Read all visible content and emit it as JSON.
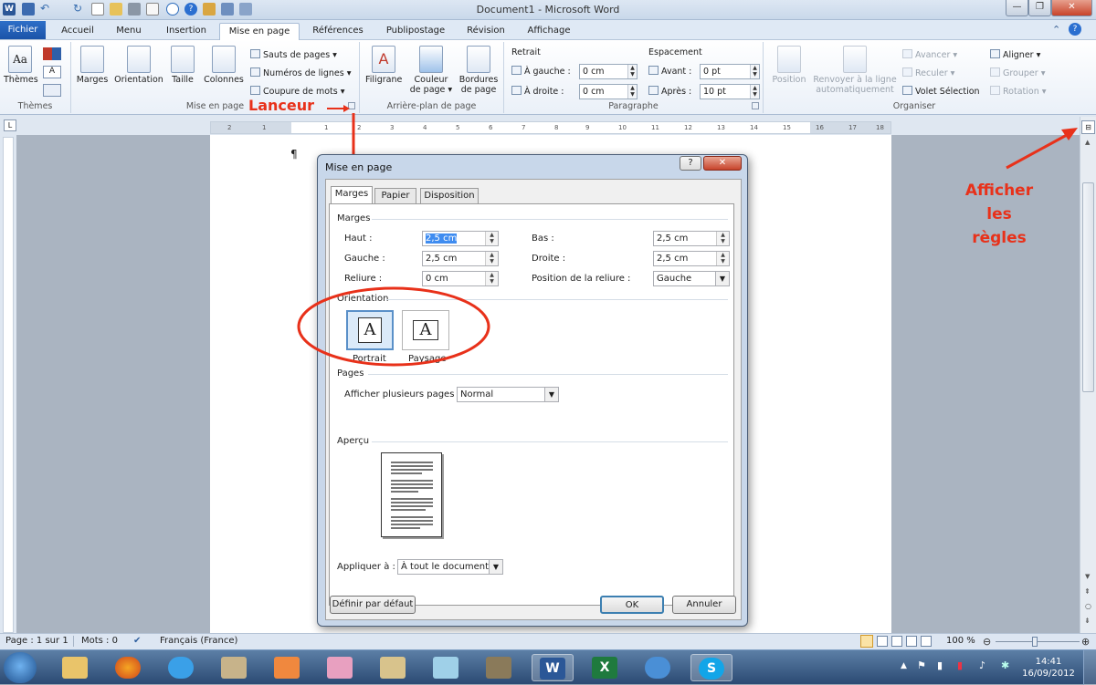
{
  "window": {
    "title": "Document1 - Microsoft Word",
    "minimize_label": "—",
    "maximize_label": "❐",
    "close_label": "✕"
  },
  "tabs": {
    "fichier": "Fichier",
    "items": [
      "Accueil",
      "Menu",
      "Insertion",
      "Mise en page",
      "Références",
      "Publipostage",
      "Révision",
      "Affichage"
    ],
    "active": "Mise en page"
  },
  "ribbon": {
    "themes": {
      "label": "Thèmes",
      "group": "Thèmes"
    },
    "mise_en_page": {
      "marges": "Marges",
      "orientation": "Orientation",
      "taille": "Taille",
      "colonnes": "Colonnes",
      "sauts": "Sauts de pages",
      "numeros": "Numéros de lignes",
      "coupure": "Coupure de mots",
      "group": "Mise en page"
    },
    "arriere_plan": {
      "filigrane": "Filigrane",
      "couleur": "Couleur de page",
      "bordures": "Bordures de page",
      "group": "Arrière-plan de page"
    },
    "paragraphe": {
      "retrait": "Retrait",
      "gauche_label": "À gauche :",
      "gauche_value": "0 cm",
      "droite_label": "À droite :",
      "droite_value": "0 cm",
      "espacement": "Espacement",
      "avant_label": "Avant :",
      "avant_value": "0  pt",
      "apres_label": "Après :",
      "apres_value": "10  pt",
      "group": "Paragraphe"
    },
    "organiser": {
      "position": "Position",
      "renvoyer": "Renvoyer à la ligne automatiquement",
      "avancer": "Avancer",
      "reculer": "Reculer",
      "volet": "Volet Sélection",
      "aligner": "Aligner",
      "grouper": "Grouper",
      "rotation": "Rotation",
      "group": "Organiser"
    }
  },
  "ruler": {
    "marks": [
      "2",
      "1",
      "1",
      "2",
      "3",
      "4",
      "5",
      "6",
      "7",
      "8",
      "9",
      "10",
      "11",
      "12",
      "13",
      "14",
      "15",
      "16",
      "17",
      "18"
    ]
  },
  "document": {
    "pilcrow": "¶"
  },
  "annotations": {
    "lanceur": "Lanceur",
    "afficher_line1": "Afficher",
    "afficher_line2": "les règles"
  },
  "dialog": {
    "title": "Mise en page",
    "help": "?",
    "close": "✕",
    "tabs": [
      "Marges",
      "Papier",
      "Disposition"
    ],
    "marges": {
      "section": "Marges",
      "haut_label": "Haut :",
      "haut_value": "2,5 cm",
      "bas_label": "Bas :",
      "bas_value": "2,5 cm",
      "gauche_label": "Gauche :",
      "gauche_value": "2,5 cm",
      "droite_label": "Droite :",
      "droite_value": "2,5 cm",
      "reliure_label": "Reliure :",
      "reliure_value": "0 cm",
      "position_label": "Position de la reliure :",
      "position_value": "Gauche"
    },
    "orientation": {
      "section": "Orientation",
      "portrait": "Portrait",
      "paysage": "Paysage",
      "selected": "Portrait"
    },
    "pages": {
      "section": "Pages",
      "label": "Afficher plusieurs pages :",
      "value": "Normal"
    },
    "apercu": {
      "section": "Aperçu"
    },
    "appliquer": {
      "label": "Appliquer à :",
      "value": "À tout le document"
    },
    "buttons": {
      "defaut": "Définir par défaut",
      "ok": "OK",
      "annuler": "Annuler"
    }
  },
  "status": {
    "page": "Page : 1 sur 1",
    "mots": "Mots : 0",
    "langue": "Français (France)",
    "zoom": "100 %"
  },
  "taskbar": {
    "time": "14:41",
    "date": "16/09/2012"
  },
  "colors": {
    "accent": "#2b5797",
    "annotation": "#e8311a",
    "ribbon_tab_active": "#ffffff"
  }
}
